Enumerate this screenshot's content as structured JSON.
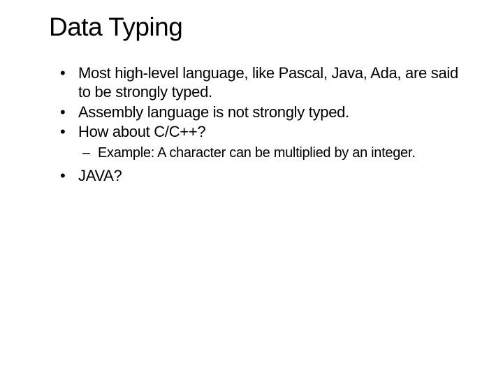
{
  "slide": {
    "title": "Data Typing",
    "bullets": [
      {
        "text": "Most high-level language, like Pascal, Java, Ada, are said to be strongly typed."
      },
      {
        "text": "Assembly language is not strongly typed."
      },
      {
        "text": "How about C/C++?",
        "sub": [
          "Example: A character can be multiplied by an integer."
        ]
      },
      {
        "text": "JAVA?"
      }
    ]
  }
}
